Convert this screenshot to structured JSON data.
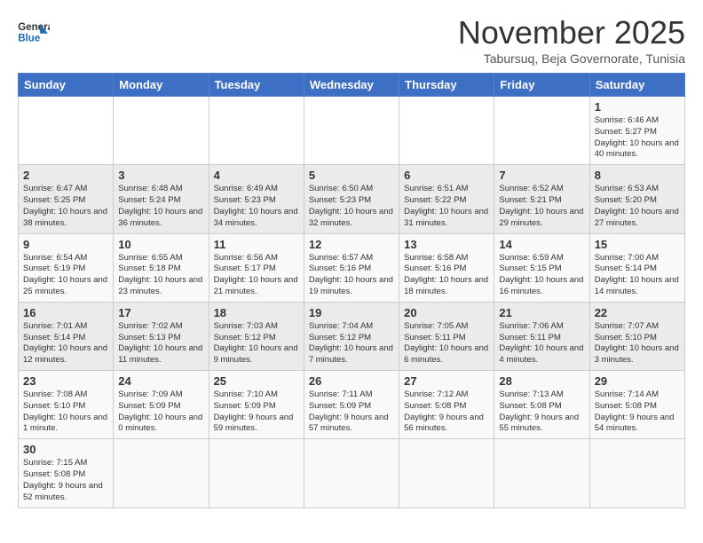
{
  "header": {
    "logo_general": "General",
    "logo_blue": "Blue",
    "title": "November 2025",
    "subtitle": "Tabursuq, Beja Governorate, Tunisia"
  },
  "weekdays": [
    "Sunday",
    "Monday",
    "Tuesday",
    "Wednesday",
    "Thursday",
    "Friday",
    "Saturday"
  ],
  "weeks": [
    [
      {
        "day": "",
        "info": ""
      },
      {
        "day": "",
        "info": ""
      },
      {
        "day": "",
        "info": ""
      },
      {
        "day": "",
        "info": ""
      },
      {
        "day": "",
        "info": ""
      },
      {
        "day": "",
        "info": ""
      },
      {
        "day": "1",
        "info": "Sunrise: 6:46 AM\nSunset: 5:27 PM\nDaylight: 10 hours\nand 40 minutes."
      }
    ],
    [
      {
        "day": "2",
        "info": "Sunrise: 6:47 AM\nSunset: 5:25 PM\nDaylight: 10 hours\nand 38 minutes."
      },
      {
        "day": "3",
        "info": "Sunrise: 6:48 AM\nSunset: 5:24 PM\nDaylight: 10 hours\nand 36 minutes."
      },
      {
        "day": "4",
        "info": "Sunrise: 6:49 AM\nSunset: 5:23 PM\nDaylight: 10 hours\nand 34 minutes."
      },
      {
        "day": "5",
        "info": "Sunrise: 6:50 AM\nSunset: 5:23 PM\nDaylight: 10 hours\nand 32 minutes."
      },
      {
        "day": "6",
        "info": "Sunrise: 6:51 AM\nSunset: 5:22 PM\nDaylight: 10 hours\nand 31 minutes."
      },
      {
        "day": "7",
        "info": "Sunrise: 6:52 AM\nSunset: 5:21 PM\nDaylight: 10 hours\nand 29 minutes."
      },
      {
        "day": "8",
        "info": "Sunrise: 6:53 AM\nSunset: 5:20 PM\nDaylight: 10 hours\nand 27 minutes."
      }
    ],
    [
      {
        "day": "9",
        "info": "Sunrise: 6:54 AM\nSunset: 5:19 PM\nDaylight: 10 hours\nand 25 minutes."
      },
      {
        "day": "10",
        "info": "Sunrise: 6:55 AM\nSunset: 5:18 PM\nDaylight: 10 hours\nand 23 minutes."
      },
      {
        "day": "11",
        "info": "Sunrise: 6:56 AM\nSunset: 5:17 PM\nDaylight: 10 hours\nand 21 minutes."
      },
      {
        "day": "12",
        "info": "Sunrise: 6:57 AM\nSunset: 5:16 PM\nDaylight: 10 hours\nand 19 minutes."
      },
      {
        "day": "13",
        "info": "Sunrise: 6:58 AM\nSunset: 5:16 PM\nDaylight: 10 hours\nand 18 minutes."
      },
      {
        "day": "14",
        "info": "Sunrise: 6:59 AM\nSunset: 5:15 PM\nDaylight: 10 hours\nand 16 minutes."
      },
      {
        "day": "15",
        "info": "Sunrise: 7:00 AM\nSunset: 5:14 PM\nDaylight: 10 hours\nand 14 minutes."
      }
    ],
    [
      {
        "day": "16",
        "info": "Sunrise: 7:01 AM\nSunset: 5:14 PM\nDaylight: 10 hours\nand 12 minutes."
      },
      {
        "day": "17",
        "info": "Sunrise: 7:02 AM\nSunset: 5:13 PM\nDaylight: 10 hours\nand 11 minutes."
      },
      {
        "day": "18",
        "info": "Sunrise: 7:03 AM\nSunset: 5:12 PM\nDaylight: 10 hours\nand 9 minutes."
      },
      {
        "day": "19",
        "info": "Sunrise: 7:04 AM\nSunset: 5:12 PM\nDaylight: 10 hours\nand 7 minutes."
      },
      {
        "day": "20",
        "info": "Sunrise: 7:05 AM\nSunset: 5:11 PM\nDaylight: 10 hours\nand 6 minutes."
      },
      {
        "day": "21",
        "info": "Sunrise: 7:06 AM\nSunset: 5:11 PM\nDaylight: 10 hours\nand 4 minutes."
      },
      {
        "day": "22",
        "info": "Sunrise: 7:07 AM\nSunset: 5:10 PM\nDaylight: 10 hours\nand 3 minutes."
      }
    ],
    [
      {
        "day": "23",
        "info": "Sunrise: 7:08 AM\nSunset: 5:10 PM\nDaylight: 10 hours\nand 1 minute."
      },
      {
        "day": "24",
        "info": "Sunrise: 7:09 AM\nSunset: 5:09 PM\nDaylight: 10 hours\nand 0 minutes."
      },
      {
        "day": "25",
        "info": "Sunrise: 7:10 AM\nSunset: 5:09 PM\nDaylight: 9 hours\nand 59 minutes."
      },
      {
        "day": "26",
        "info": "Sunrise: 7:11 AM\nSunset: 5:09 PM\nDaylight: 9 hours\nand 57 minutes."
      },
      {
        "day": "27",
        "info": "Sunrise: 7:12 AM\nSunset: 5:08 PM\nDaylight: 9 hours\nand 56 minutes."
      },
      {
        "day": "28",
        "info": "Sunrise: 7:13 AM\nSunset: 5:08 PM\nDaylight: 9 hours\nand 55 minutes."
      },
      {
        "day": "29",
        "info": "Sunrise: 7:14 AM\nSunset: 5:08 PM\nDaylight: 9 hours\nand 54 minutes."
      }
    ],
    [
      {
        "day": "30",
        "info": "Sunrise: 7:15 AM\nSunset: 5:08 PM\nDaylight: 9 hours\nand 52 minutes."
      },
      {
        "day": "",
        "info": ""
      },
      {
        "day": "",
        "info": ""
      },
      {
        "day": "",
        "info": ""
      },
      {
        "day": "",
        "info": ""
      },
      {
        "day": "",
        "info": ""
      },
      {
        "day": "",
        "info": ""
      }
    ]
  ]
}
